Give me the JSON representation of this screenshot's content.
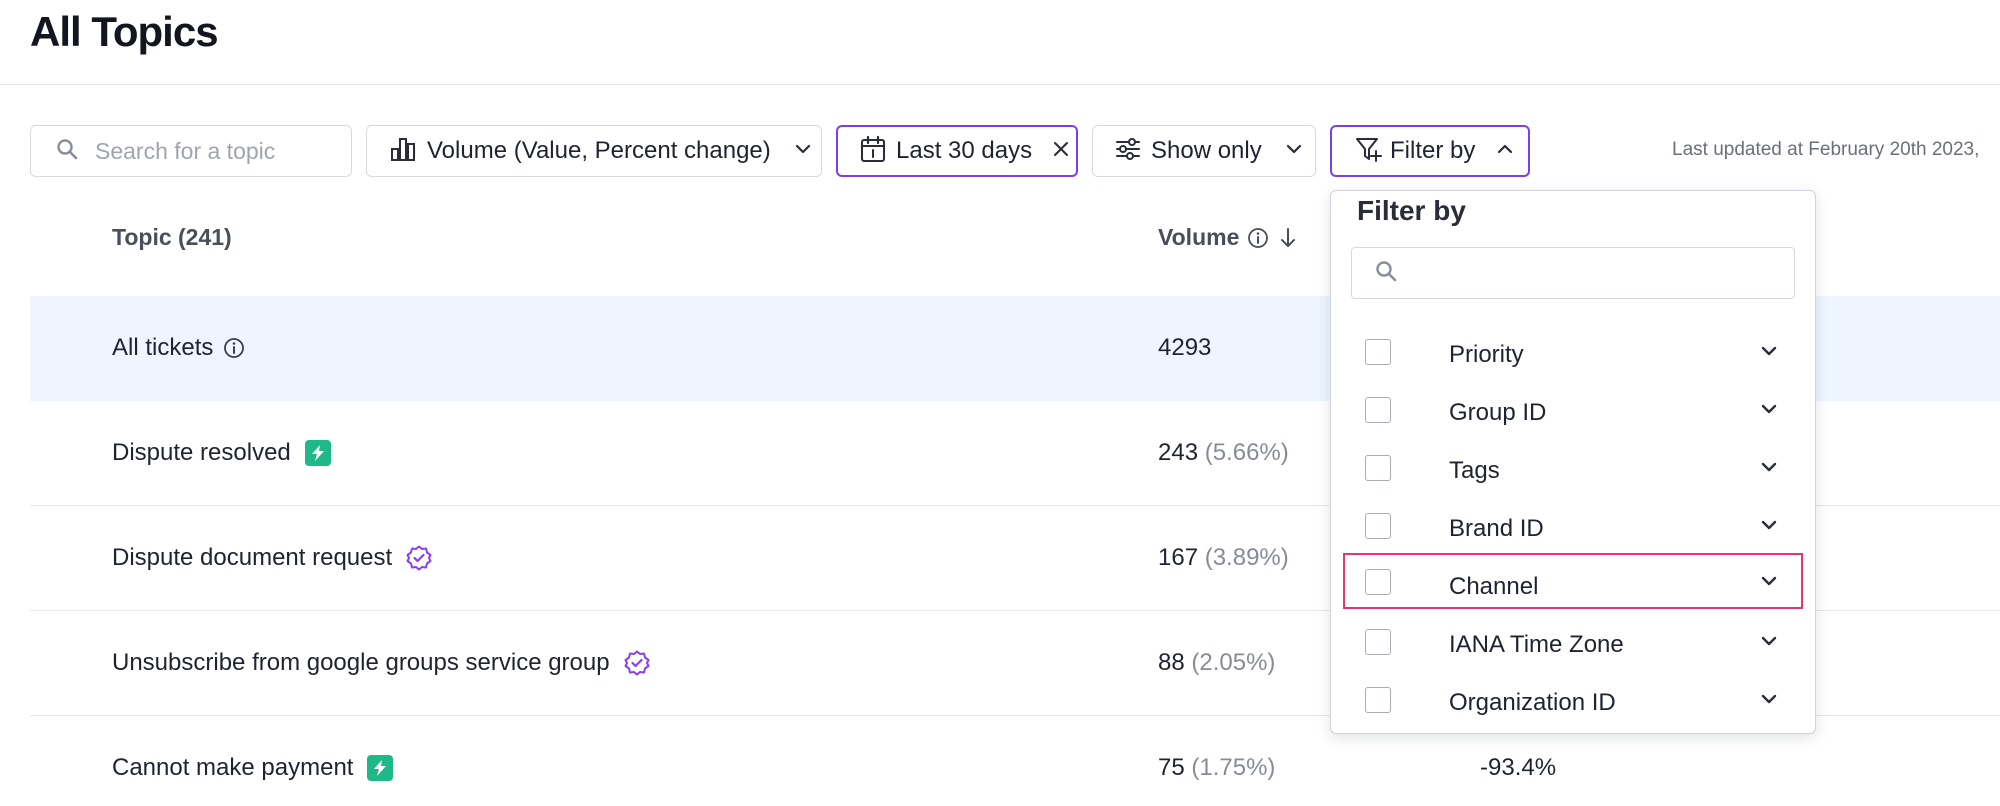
{
  "page": {
    "title": "All Topics"
  },
  "toolbar": {
    "search_placeholder": "Search for a topic",
    "metric_label": "Volume (Value, Percent change)",
    "date_label": "Last 30 days",
    "showonly_label": "Show only",
    "filterby_label": "Filter by",
    "last_updated": "Last updated at February 20th 2023,"
  },
  "table": {
    "columns": {
      "topic": "Topic (241)",
      "volume": "Volume"
    },
    "rows": [
      {
        "topic": "All tickets",
        "badge": "info-icon",
        "volume": "4293",
        "percent": "",
        "change": ""
      },
      {
        "topic": "Dispute resolved",
        "badge": "lightning-icon",
        "volume": "243",
        "percent": "(5.66%)",
        "change": ""
      },
      {
        "topic": "Dispute document request",
        "badge": "verified-icon",
        "volume": "167",
        "percent": "(3.89%)",
        "change": ""
      },
      {
        "topic": "Unsubscribe from google groups service group",
        "badge": "verified-icon",
        "volume": "88",
        "percent": "(2.05%)",
        "change": ""
      },
      {
        "topic": "Cannot make payment",
        "badge": "lightning-icon",
        "volume": "75",
        "percent": "(1.75%)",
        "change": "-93.4%"
      }
    ]
  },
  "filter_dropdown": {
    "title": "Filter by",
    "search_value": "",
    "items": [
      {
        "label": "Priority",
        "checked": false
      },
      {
        "label": "Group ID",
        "checked": false
      },
      {
        "label": "Tags",
        "checked": false
      },
      {
        "label": "Brand ID",
        "checked": false
      },
      {
        "label": "Channel",
        "checked": false,
        "highlighted": true
      },
      {
        "label": "IANA Time Zone",
        "checked": false
      },
      {
        "label": "Organization ID",
        "checked": false
      }
    ]
  },
  "colors": {
    "accent": "#7b3fe4",
    "highlight_row": "#eef5fe",
    "bolt_badge": "#1fb987",
    "focus_outline": "#e2366f"
  }
}
